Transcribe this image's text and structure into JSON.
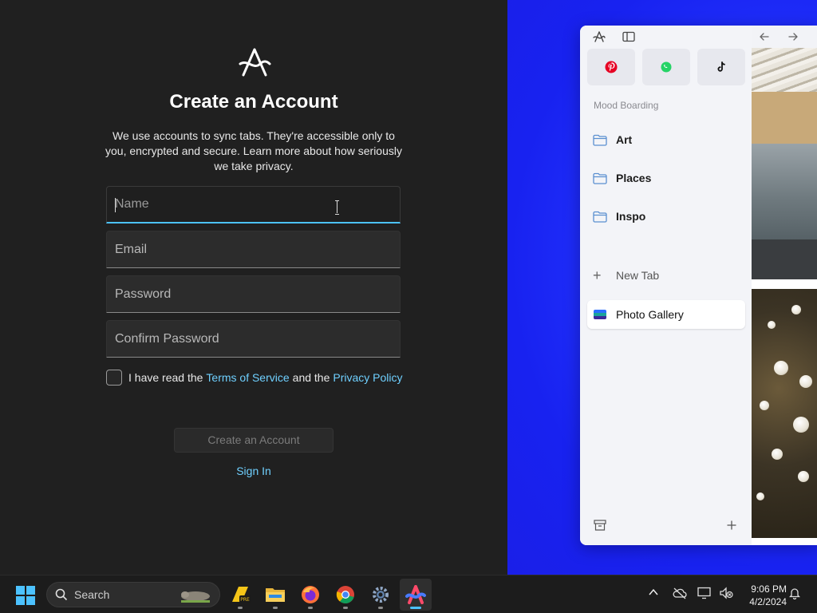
{
  "signup": {
    "title": "Create an Account",
    "description": "We use accounts to sync tabs. They're accessible only to you, encrypted and secure. Learn more about how seriously we take privacy.",
    "fields": {
      "name_placeholder": "Name",
      "email_placeholder": "Email",
      "password_placeholder": "Password",
      "confirm_placeholder": "Confirm Password"
    },
    "terms": {
      "prefix": "I have read the",
      "tos_link": "Terms of Service",
      "middle": "and the",
      "privacy_link": "Privacy Policy",
      "checked": false
    },
    "create_button": "Create an Account",
    "signin_link": "Sign In",
    "accent_color": "#6fd0ff"
  },
  "arc_window": {
    "toolbar_icons": [
      "arc-logo-icon",
      "sidebar-toggle-icon",
      "back-arrow-icon",
      "forward-arrow-icon"
    ],
    "favorites": [
      {
        "name": "pinterest",
        "icon": "pinterest-icon",
        "color": "#e60023"
      },
      {
        "name": "whatsapp",
        "icon": "whatsapp-icon",
        "color": "#25d366"
      },
      {
        "name": "tiktok",
        "icon": "tiktok-icon",
        "color": "#111111"
      }
    ],
    "space_label": "Mood Boarding",
    "folders": [
      {
        "label": "Art"
      },
      {
        "label": "Places"
      },
      {
        "label": "Inspo"
      }
    ],
    "new_tab": "New Tab",
    "tabs": [
      {
        "label": "Photo Gallery",
        "active": true
      }
    ],
    "bottom_icons": [
      "archive-icon",
      "plus-icon"
    ]
  },
  "taskbar": {
    "search_placeholder": "Search",
    "apps": [
      {
        "name": "photoshop-pre-icon",
        "label": "PRE"
      },
      {
        "name": "file-explorer-icon"
      },
      {
        "name": "firefox-icon"
      },
      {
        "name": "chrome-icon"
      },
      {
        "name": "settings-icon"
      },
      {
        "name": "arc-browser-icon",
        "active": true
      }
    ],
    "time": "9:06 PM",
    "date": "4/2/2024"
  }
}
